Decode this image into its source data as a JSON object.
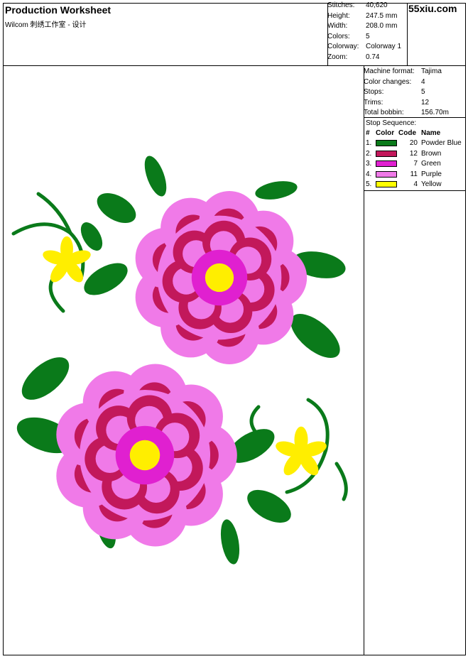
{
  "header": {
    "title": "Production Worksheet",
    "subtitle": "Wilcom 刺绣工作室 - 设计",
    "brand": "55xiu.com"
  },
  "stats": [
    {
      "label": "Stitches:",
      "value": "40,620"
    },
    {
      "label": "Height:",
      "value": "247.5 mm"
    },
    {
      "label": "Width:",
      "value": "208.0 mm"
    },
    {
      "label": "Colors:",
      "value": "5"
    },
    {
      "label": "Colorway:",
      "value": "Colorway 1"
    },
    {
      "label": "Zoom:",
      "value": "0.74"
    }
  ],
  "machine": [
    {
      "label": "Machine format:",
      "value": "Tajima"
    },
    {
      "label": "Color changes:",
      "value": "4"
    },
    {
      "label": "Stops:",
      "value": "5"
    },
    {
      "label": "Trims:",
      "value": "12"
    },
    {
      "label": "Total bobbin:",
      "value": "156.70m"
    }
  ],
  "stop_sequence": {
    "heading": "Stop Sequence:",
    "columns": {
      "num": "#",
      "color": "Color",
      "code": "Code",
      "name": "Name"
    },
    "rows": [
      {
        "num": "1.",
        "swatch": "#0a7a1a",
        "code": "20",
        "name": "Powder Blue"
      },
      {
        "num": "2.",
        "swatch": "#c2185b",
        "code": "12",
        "name": "Brown"
      },
      {
        "num": "3.",
        "swatch": "#e020d0",
        "code": "7",
        "name": "Green"
      },
      {
        "num": "4.",
        "swatch": "#f07ae8",
        "code": "11",
        "name": "Purple"
      },
      {
        "num": "5.",
        "swatch": "#ffff00",
        "code": "4",
        "name": "Yellow"
      }
    ]
  },
  "design_colors": {
    "leaf": "#0a7a1a",
    "deep_pink": "#c2185b",
    "magenta": "#e020d0",
    "light_pink": "#f07ae8",
    "yellow": "#ffee00"
  }
}
